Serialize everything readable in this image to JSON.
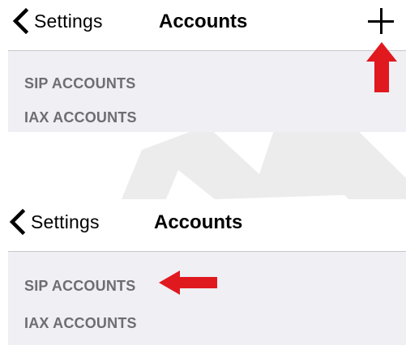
{
  "top_screen": {
    "navbar": {
      "back_label": "Settings",
      "title": "Accounts",
      "add_icon": "plus-icon"
    },
    "list": {
      "items": [
        {
          "label": "SIP ACCOUNTS"
        },
        {
          "label": "IAX ACCOUNTS"
        }
      ]
    }
  },
  "bottom_screen": {
    "navbar": {
      "back_label": "Settings",
      "title": "Accounts"
    },
    "list": {
      "items": [
        {
          "label": "SIP ACCOUNTS"
        },
        {
          "label": "IAX ACCOUNTS"
        }
      ]
    }
  },
  "colors": {
    "panel_bg": "#efeff4",
    "row_text": "#6d6d72",
    "annotation_red": "#e0191f",
    "watermark_gray": "#ececec"
  }
}
